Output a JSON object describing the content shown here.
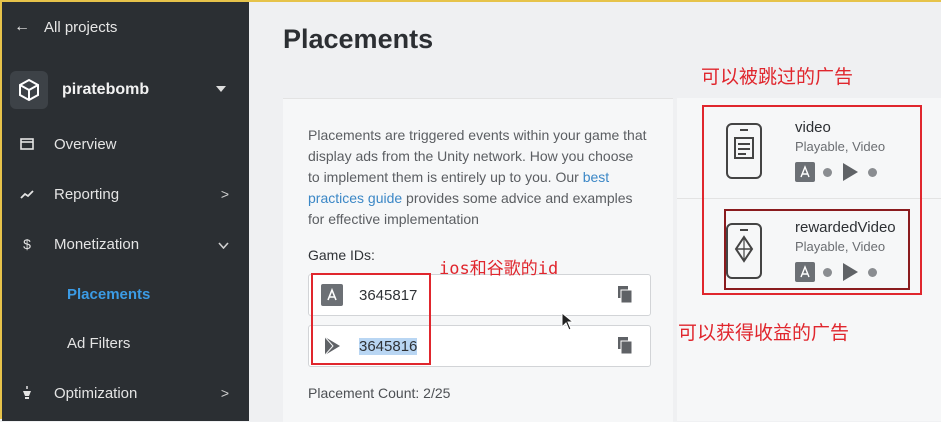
{
  "sidebar": {
    "back_label": "All projects",
    "project_name": "piratebomb",
    "items": [
      {
        "label": "Overview",
        "icon": "overview-icon"
      },
      {
        "label": "Reporting",
        "icon": "trending-up-icon"
      },
      {
        "label": "Monetization",
        "icon": "dollar-icon"
      },
      {
        "label": "Optimization",
        "icon": "bulb-icon"
      }
    ],
    "sub_items": [
      {
        "label": "Placements",
        "active": true
      },
      {
        "label": "Ad Filters",
        "active": false
      }
    ]
  },
  "main": {
    "title": "Placements",
    "description_pre": "Placements are triggered events within your game that display ads from the Unity network. How you choose to implement them is entirely up to you. Our ",
    "description_link": "best practices guide",
    "description_post": " provides some advice and examples for effective implementation",
    "game_ids_label": "Game IDs:",
    "game_ids": [
      {
        "platform": "apple-app-store-icon",
        "value": "3645817"
      },
      {
        "platform": "google-play-icon",
        "value": "3645816"
      }
    ],
    "placement_count": "Placement Count: 2/25",
    "placements": [
      {
        "name": "video",
        "types": "Playable, Video"
      },
      {
        "name": "rewardedVideo",
        "types": "Playable, Video"
      }
    ]
  },
  "annotations": {
    "skippable": "可以被跳过的广告",
    "ids_note": "ios和谷歌的id",
    "rewarded": "可以获得收益的广告"
  },
  "colors": {
    "sidebar_bg": "#2b2f33",
    "accent": "#3b9be5",
    "annotation_red": "#e0262d",
    "highlight": "#e6c34a"
  }
}
